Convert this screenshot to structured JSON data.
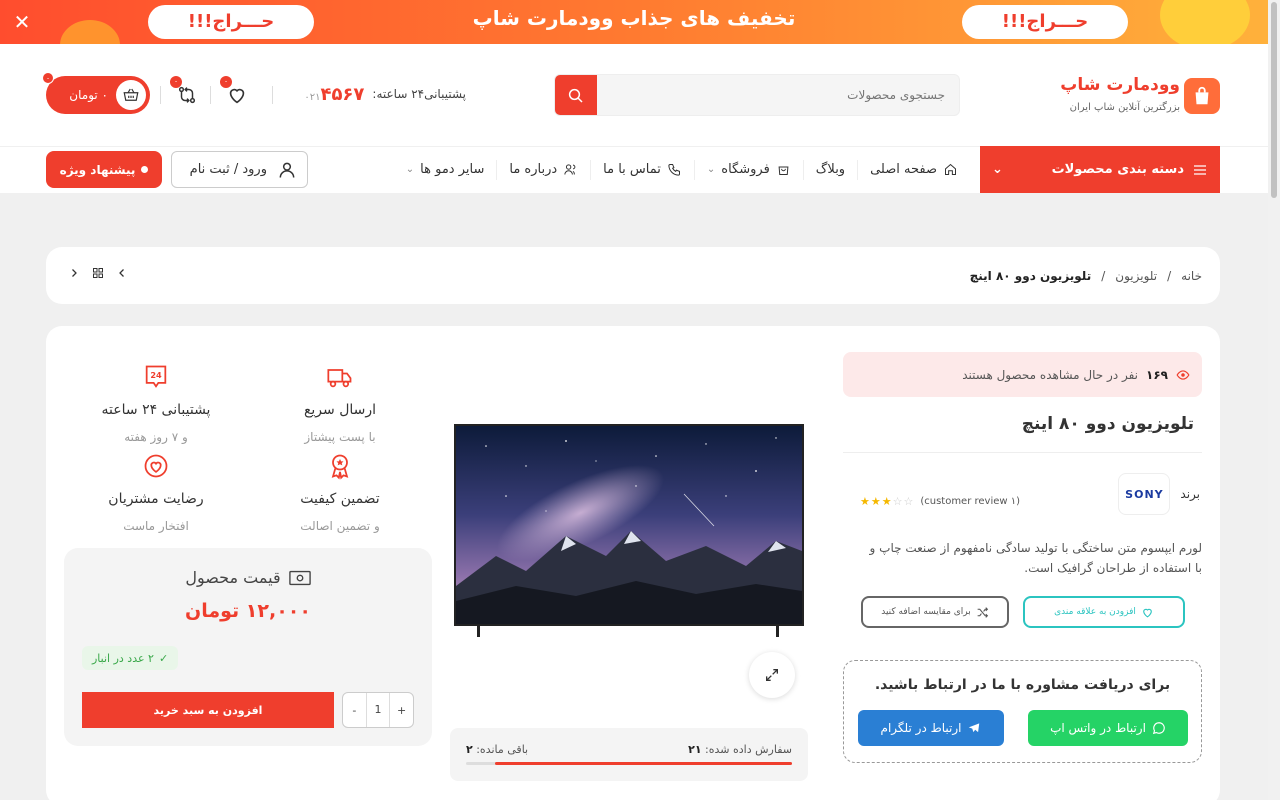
{
  "promo": {
    "headline": "تخفیف های جذاب وودمارت شاپ",
    "pill_left": "حـــراج!!!",
    "pill_right": "حـــراج!!!"
  },
  "header": {
    "logo_title": "وودمارت شاپ",
    "logo_sub": "بزرگترین آنلاین شاپ ایران",
    "search_placeholder": "جستجوی محصولات",
    "support_label": "پشتیبانی۲۴ ساعته:",
    "phone_prefix": "۰۲۱",
    "phone": "۴۵۶۷",
    "wishlist_count": "۰",
    "compare_count": "۰",
    "cart_count": "۰",
    "cart_total": "۰ تومان"
  },
  "nav": {
    "category_label": "دسته بندی محصولات",
    "items": [
      {
        "label": "صفحه اصلی",
        "icon": "home-icon"
      },
      {
        "label": "وبلاگ",
        "icon": ""
      },
      {
        "label": "فروشگاه",
        "icon": "bag-icon"
      },
      {
        "label": "تماس با ما",
        "icon": "phone-icon"
      },
      {
        "label": "درباره ما",
        "icon": "users-icon"
      },
      {
        "label": "سایر دمو ها",
        "icon": ""
      }
    ],
    "login_label": "ورود / ثبت نام",
    "special_label": "پیشنهاد ویژه"
  },
  "breadcrumb": {
    "home": "خانه",
    "category": "تلویزیون",
    "sep": "/",
    "current": "تلویزیون دوو ۸۰ اینچ"
  },
  "product": {
    "viewers_count": "۱۶۹",
    "viewers_text": "نفر در حال مشاهده محصول هستند",
    "title": "تلویزیون دوو ۸۰ اینچ",
    "brand_label": "برند",
    "brand_logo": "SONY",
    "rating": 3,
    "review_text": "(customer review ۱)",
    "description": "لورم ایپسوم متن ساختگی با تولید سادگی نامفهوم از صنعت چاپ و با استفاده از طراحان گرافیک است.",
    "wishlist_label": "افزودن به علاقه مندی",
    "compare_label": "برای مقایسه اضافه کنید",
    "consult_title": "برای دریافت مشاوره با ما در ارتباط باشید.",
    "whatsapp_label": "ارتباط در واتس اپ",
    "telegram_label": "ارتباط در تلگرام",
    "ordered_label": "سفارش داده شده:",
    "ordered_value": "۲۱",
    "remaining_label": "باقی مانده:",
    "remaining_value": "۲",
    "sold_fraction": 0.91
  },
  "features": [
    {
      "title": "ارسال سریع",
      "sub": "با پست پیشتاز",
      "icon": "truck-icon"
    },
    {
      "title": "پشتیبانی ۲۴ ساعته",
      "sub": "و ۷ روز هفته",
      "icon": "support-24-icon"
    },
    {
      "title": "تضمین کیفیت",
      "sub": "و تضمین اصالت",
      "icon": "medal-icon"
    },
    {
      "title": "رضایت مشتریان",
      "sub": "افتخار ماست",
      "icon": "heart-badge-icon"
    }
  ],
  "price": {
    "label": "قیمت محصول",
    "value": "۱۲,۰۰۰ تومان",
    "stock": "۲ عدد در انبار",
    "add_to_cart": "افزودن به سبد خرید",
    "qty": "1",
    "plus": "+",
    "minus": "-"
  },
  "colors": {
    "accent": "#ef3e2d",
    "teal": "#2bc4c0",
    "whatsapp": "#25d366",
    "telegram": "#2a7fd4"
  }
}
